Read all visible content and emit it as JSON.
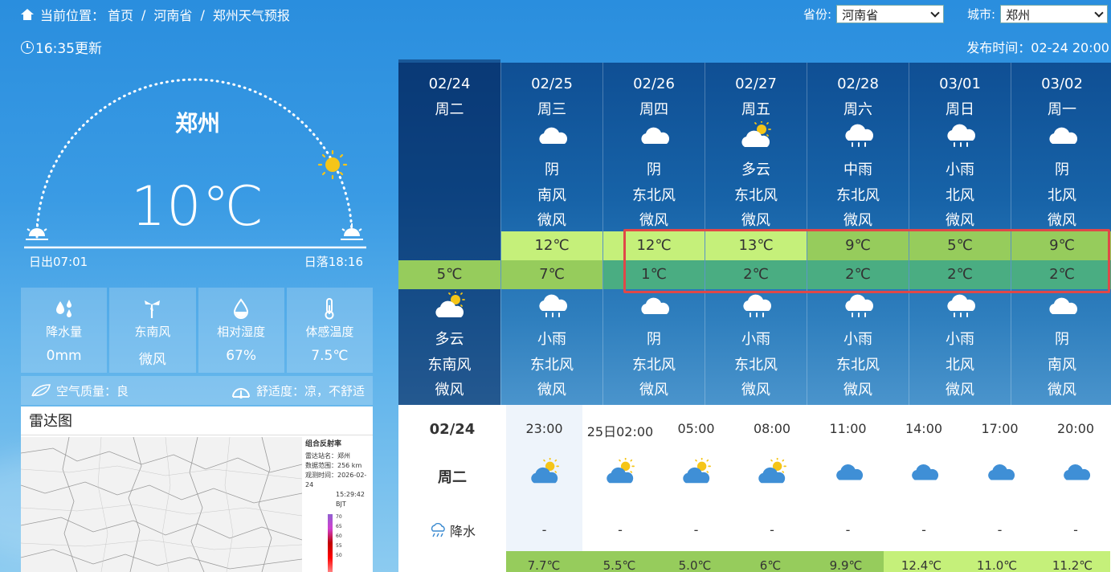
{
  "breadcrumb": {
    "prefix": "当前位置：",
    "items": [
      "首页",
      "河南省",
      "郑州天气预报"
    ]
  },
  "province": {
    "label": "省份:",
    "value": "河南省"
  },
  "city_select": {
    "label": "城市:",
    "value": "郑州"
  },
  "update_time": "16:35更新",
  "publish_time": "发布时间：02-24 20:00",
  "current": {
    "city": "郑州",
    "temp": "10℃",
    "sunrise": "日出07:01",
    "sunset": "日落18:16"
  },
  "tiles": [
    {
      "label": "降水量",
      "value": "0mm",
      "icon": "rain-drops-icon"
    },
    {
      "label": "东南风",
      "value": "微风",
      "icon": "windmill-icon"
    },
    {
      "label": "相对湿度",
      "value": "67%",
      "icon": "humidity-drop-icon"
    },
    {
      "label": "体感温度",
      "value": "7.5℃",
      "icon": "thermometer-icon"
    }
  ],
  "air_quality": "空气质量：良",
  "comfort": "舒适度：凉，不舒适",
  "radar": {
    "title": "雷达图",
    "side_title": "组合反射率",
    "station": "雷达站名：郑州",
    "range": "数据范围：256 km",
    "observe": "观测时间：2026-02-24",
    "observe_time": "15:29:42 BJT",
    "scale": [
      "70",
      "65",
      "60",
      "55",
      "50"
    ]
  },
  "forecast": [
    {
      "date": "02/24",
      "week": "周二",
      "day_weather": "",
      "day_wind_dir": "",
      "day_wind_level": "",
      "high": "",
      "low": "5℃",
      "night_weather": "多云",
      "night_wind_dir": "东南风",
      "night_wind_level": "微风",
      "day_icon": "",
      "night_icon": "partly-cloudy-night-icon"
    },
    {
      "date": "02/25",
      "week": "周三",
      "day_weather": "阴",
      "day_wind_dir": "南风",
      "day_wind_level": "微风",
      "high": "12℃",
      "low": "7℃",
      "night_weather": "小雨",
      "night_wind_dir": "东北风",
      "night_wind_level": "微风",
      "day_icon": "cloud",
      "night_icon": "rain"
    },
    {
      "date": "02/26",
      "week": "周四",
      "day_weather": "阴",
      "day_wind_dir": "东北风",
      "day_wind_level": "微风",
      "high": "12℃",
      "low": "1℃",
      "night_weather": "阴",
      "night_wind_dir": "东北风",
      "night_wind_level": "微风",
      "day_icon": "cloud",
      "night_icon": "cloud"
    },
    {
      "date": "02/27",
      "week": "周五",
      "day_weather": "多云",
      "day_wind_dir": "东北风",
      "day_wind_level": "微风",
      "high": "13℃",
      "low": "2℃",
      "night_weather": "小雨",
      "night_wind_dir": "东北风",
      "night_wind_level": "微风",
      "day_icon": "sun-cloud",
      "night_icon": "rain"
    },
    {
      "date": "02/28",
      "week": "周六",
      "day_weather": "中雨",
      "day_wind_dir": "东北风",
      "day_wind_level": "微风",
      "high": "9℃",
      "low": "2℃",
      "night_weather": "小雨",
      "night_wind_dir": "东北风",
      "night_wind_level": "微风",
      "day_icon": "rain",
      "night_icon": "rain"
    },
    {
      "date": "03/01",
      "week": "周日",
      "day_weather": "小雨",
      "day_wind_dir": "北风",
      "day_wind_level": "微风",
      "high": "5℃",
      "low": "2℃",
      "night_weather": "小雨",
      "night_wind_dir": "北风",
      "night_wind_level": "微风",
      "day_icon": "rain",
      "night_icon": "rain"
    },
    {
      "date": "03/02",
      "week": "周一",
      "day_weather": "阴",
      "day_wind_dir": "北风",
      "day_wind_level": "微风",
      "high": "9℃",
      "low": "2℃",
      "night_weather": "阴",
      "night_wind_dir": "南风",
      "night_wind_level": "微风",
      "day_icon": "cloud",
      "night_icon": "cloud"
    }
  ],
  "colors": {
    "high_light": "#c5f07a",
    "high_mid": "#96cc5c",
    "low_mid": "#96cc5c",
    "low_green": "#4aad82",
    "highlight_border": "#e04848"
  },
  "hourly": {
    "date": "02/24",
    "week": "周二",
    "rain_label": "降水",
    "times": [
      "23:00",
      "25日02:00",
      "05:00",
      "08:00",
      "11:00",
      "14:00",
      "17:00",
      "20:00"
    ],
    "icons": [
      "sun-cloud",
      "sun-cloud",
      "sun-cloud",
      "sun-cloud",
      "cloud",
      "cloud",
      "cloud",
      "cloud"
    ],
    "rain": [
      "-",
      "-",
      "-",
      "-",
      "-",
      "-",
      "-",
      "-"
    ],
    "temps": [
      "7.7℃",
      "5.5℃",
      "5.0℃",
      "6℃",
      "9.9℃",
      "12.4℃",
      "11.0℃",
      "11.2℃"
    ]
  }
}
